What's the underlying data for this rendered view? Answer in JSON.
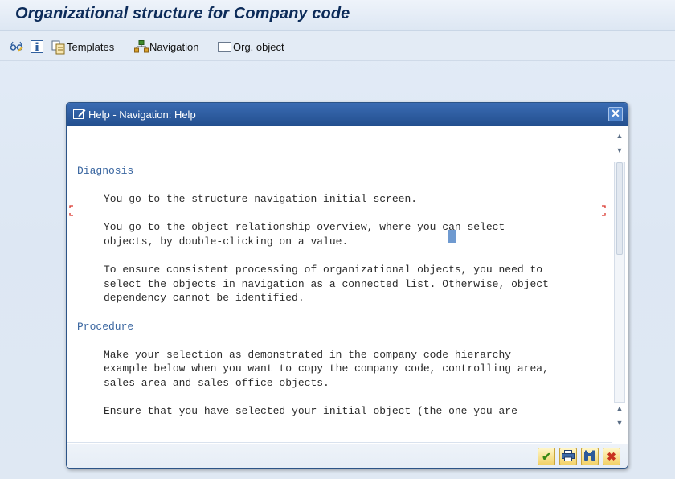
{
  "window": {
    "title": "Organizational structure for Company code"
  },
  "toolbar": {
    "templates_label": "Templates",
    "navigation_label": "Navigation",
    "org_object_label": "Org. object"
  },
  "dialog": {
    "title": "Help - Navigation: Help",
    "close_glyph": "✕",
    "sections": {
      "diagnosis_heading": "Diagnosis",
      "diagnosis_p1": "You go to the structure navigation initial screen.",
      "diagnosis_p2_l1": "You go to the object relationship overview, where you can select",
      "diagnosis_p2_l2": "objects, by double-clicking on a value.",
      "diagnosis_p3_l1": "To ensure consistent processing of organizational objects, you need to",
      "diagnosis_p3_l2": "select the objects in navigation as a connected list. Otherwise, object",
      "diagnosis_p3_l3": "dependency cannot be identified.",
      "procedure_heading": "Procedure",
      "procedure_p1_l1": "Make your selection as demonstrated in the company code hierarchy",
      "procedure_p1_l2": "example below when you want to copy the company code, controlling area,",
      "procedure_p1_l3": "sales area and sales office objects.",
      "procedure_p2_l1": "Ensure that you have selected your initial object (the one you are"
    },
    "scroll_up_glyph": "▲",
    "scroll_down_glyph": "▼",
    "footer_buttons": {
      "ok_glyph": "✔",
      "print_icon": "printer-icon",
      "find_icon": "binoculars-icon",
      "cancel_glyph": "✖"
    }
  },
  "colors": {
    "dialog_header": "#234f8e",
    "heading_text": "#3a66a0",
    "title_text": "#0c2b59",
    "ok_green": "#3a8a16",
    "cancel_red": "#c8321f"
  }
}
